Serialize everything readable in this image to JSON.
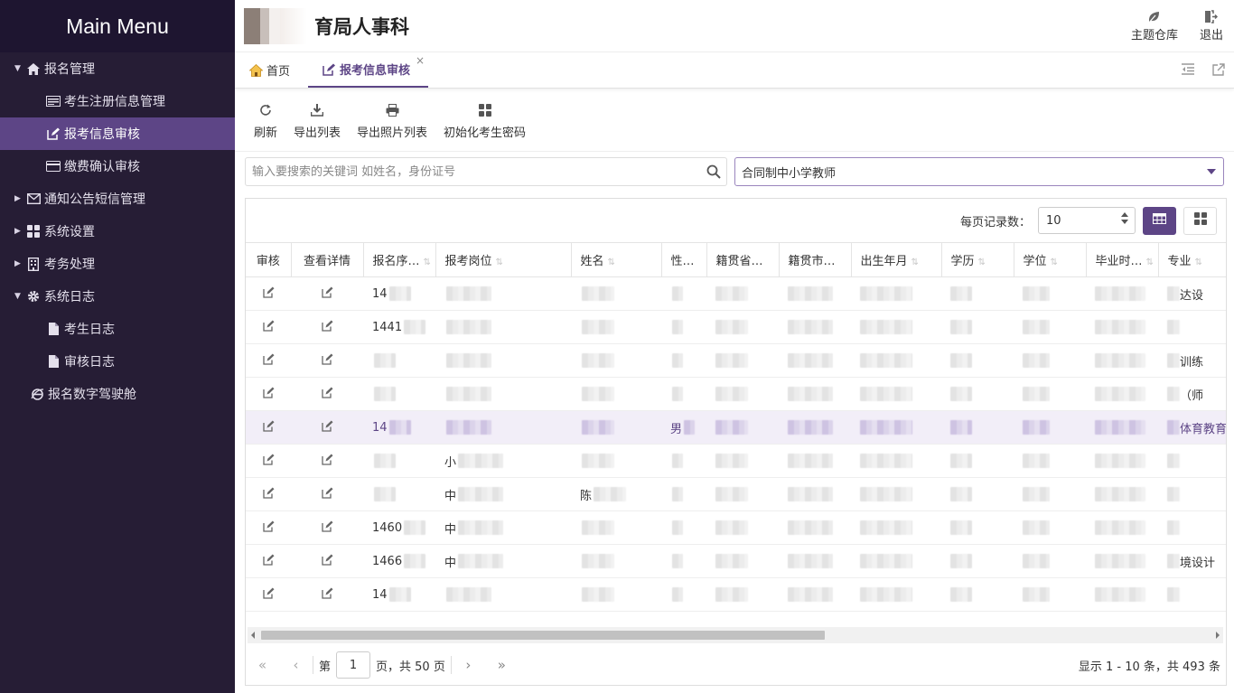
{
  "sidebar": {
    "title": "Main Menu",
    "groups": [
      {
        "label": "报名管理",
        "icon": "home-icon",
        "expanded": true,
        "items": [
          {
            "label": "考生注册信息管理",
            "icon": "id-card-icon"
          },
          {
            "label": "报考信息审核",
            "icon": "edit-icon",
            "active": true
          },
          {
            "label": "缴费确认审核",
            "icon": "credit-card-icon"
          }
        ]
      },
      {
        "label": "通知公告短信管理",
        "icon": "envelope-icon",
        "expanded": false
      },
      {
        "label": "系统设置",
        "icon": "grid-icon",
        "expanded": false
      },
      {
        "label": "考务处理",
        "icon": "building-icon",
        "expanded": false
      },
      {
        "label": "系统日志",
        "icon": "gear-icon",
        "expanded": true,
        "items": [
          {
            "label": "考生日志",
            "icon": "file-icon"
          },
          {
            "label": "审核日志",
            "icon": "file-icon"
          }
        ]
      },
      {
        "label": "报名数字驾驶舱",
        "icon": "ie-icon"
      }
    ]
  },
  "header": {
    "title": "育局人事科",
    "actions": [
      {
        "label": "主题仓库",
        "icon": "leaf-icon"
      },
      {
        "label": "退出",
        "icon": "logout-icon"
      }
    ]
  },
  "tabs": [
    {
      "label": "首页",
      "icon": "home-icon"
    },
    {
      "label": "报考信息审核",
      "icon": "edit-icon",
      "active": true,
      "close": "×"
    }
  ],
  "toolbar": [
    {
      "label": "刷新",
      "icon": "refresh-icon"
    },
    {
      "label": "导出列表",
      "icon": "download-icon"
    },
    {
      "label": "导出照片列表",
      "icon": "print-icon"
    },
    {
      "label": "初始化考生密码",
      "icon": "grid-icon"
    }
  ],
  "search": {
    "placeholder": "输入要搜索的关键词 如姓名，身份证号",
    "value": ""
  },
  "filter": {
    "selected": "合同制中小学教师"
  },
  "table": {
    "page_size_label": "每页记录数：",
    "page_size": "10",
    "columns": [
      "审核",
      "查看详情",
      "报名序…",
      "报考岗位",
      "姓名",
      "性…",
      "籍贯省…",
      "籍贯市…",
      "出生年月",
      "学历",
      "学位",
      "毕业时…",
      "专业"
    ],
    "rows": [
      {
        "id": "14",
        "job": "",
        "major": "达设"
      },
      {
        "id": "1441",
        "job": "",
        "major": ""
      },
      {
        "id": "",
        "job": "",
        "major": "训练"
      },
      {
        "id": "",
        "job": "",
        "major": "（师"
      },
      {
        "id": "14",
        "job": "",
        "major": "体育教育",
        "gender": "男",
        "highlight": true
      },
      {
        "id": "",
        "job": "小",
        "major": ""
      },
      {
        "id": "",
        "job": "中",
        "major": "",
        "name": "陈"
      },
      {
        "id": "1460",
        "job": "中",
        "major": ""
      },
      {
        "id": "1466",
        "job": "中",
        "major": "境设计"
      },
      {
        "id": "14",
        "job": "",
        "major": ""
      }
    ]
  },
  "pagination": {
    "page_prefix": "第",
    "page": "1",
    "page_suffix": "页，共 50 页",
    "summary": "显示 1 - 10 条，共 493 条"
  },
  "colors": {
    "sidebar_bg": "#261d35",
    "accent": "#5d4586",
    "highlight_row": "#f2eef8"
  }
}
